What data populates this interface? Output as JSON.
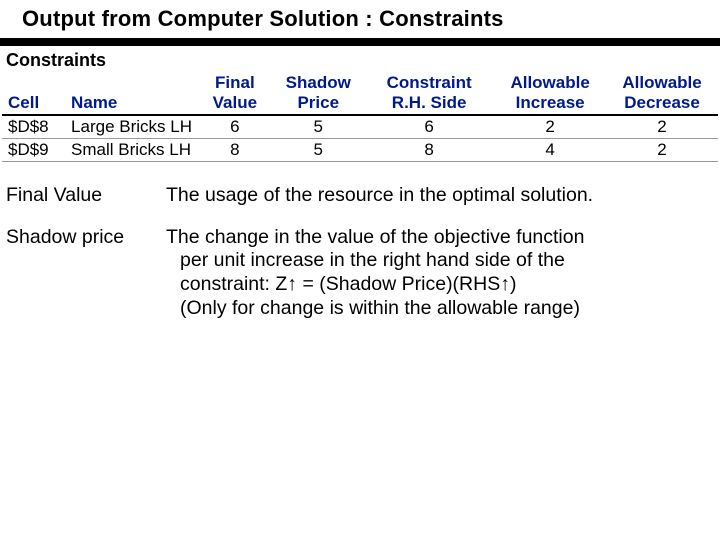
{
  "title": "Output from Computer Solution : Constraints",
  "section_heading": "Constraints",
  "headers": {
    "cell_top": "",
    "cell_bot": "Cell",
    "name_top": "",
    "name_bot": "Name",
    "final_top": "Final",
    "final_bot": "Value",
    "shadow_top": "Shadow",
    "shadow_bot": "Price",
    "rhs_top": "Constraint",
    "rhs_bot": "R.H. Side",
    "inc_top": "Allowable",
    "inc_bot": "Increase",
    "dec_top": "Allowable",
    "dec_bot": "Decrease"
  },
  "chart_data": {
    "type": "table",
    "columns": [
      "Cell",
      "Name",
      "Final Value",
      "Shadow Price",
      "Constraint R.H. Side",
      "Allowable Increase",
      "Allowable Decrease"
    ],
    "rows": [
      {
        "cell": "$D$8",
        "name": "Large Bricks LH",
        "final_value": 6,
        "shadow_price": 5,
        "rhs": 6,
        "allow_inc": 2,
        "allow_dec": 2
      },
      {
        "cell": "$D$9",
        "name": "Small Bricks LH",
        "final_value": 8,
        "shadow_price": 5,
        "rhs": 8,
        "allow_inc": 4,
        "allow_dec": 2
      }
    ]
  },
  "definitions": {
    "final_value": {
      "term": "Final Value",
      "body_l1": "The usage of the resource in the optimal solution."
    },
    "shadow_price": {
      "term": "Shadow price",
      "body_l1": "The change in the value of the objective function",
      "body_l2": "per unit increase in the right hand side of the",
      "body_l3": "constraint:  Z↑ = (Shadow Price)(RHS↑)",
      "body_l4": "(Only for change is within the allowable range)"
    }
  }
}
